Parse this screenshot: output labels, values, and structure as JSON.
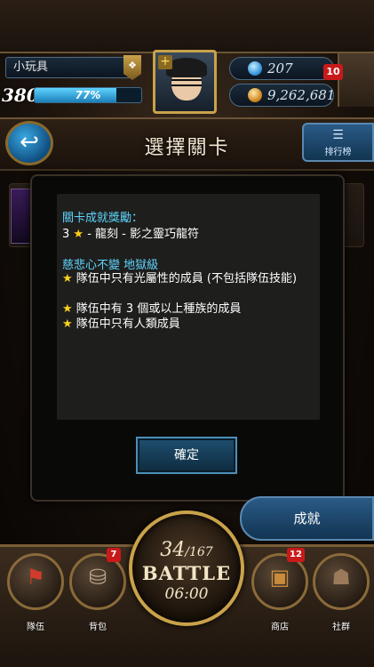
{
  "player": {
    "name": "小玩具",
    "level": "380",
    "exp_percent": 77,
    "exp_label": "77%"
  },
  "currency": {
    "gems": "207",
    "coins": "9,262,681",
    "mail_count": "10"
  },
  "header": {
    "title": "選擇關卡",
    "ranking_label": "排行榜"
  },
  "dialog": {
    "reward_heading": "關卡成就獎勵：",
    "reward_prefix": "3 ",
    "reward_star": "★",
    "reward_text": " - 龍刻 - 影之靈巧龍符",
    "mission_heading": "慈悲心不變 地獄級",
    "conditions": [
      "隊伍中只有光屬性的成員 (不包括隊伍技能)",
      "隊伍中有 3 個或以上種族的成員",
      "隊伍中只有人類成員"
    ],
    "confirm_label": "確定"
  },
  "achievement_label": "成就",
  "battle": {
    "stamina_current": "34",
    "stamina_max": "/167",
    "label": "BATTLE",
    "timer": "06:00"
  },
  "nav": {
    "team": "隊伍",
    "bag": "背包",
    "bag_badge": "7",
    "shop": "商店",
    "shop_badge": "12",
    "social": "社群"
  },
  "colors": {
    "accent_cyan": "#5fd6ff",
    "star_yellow": "#ffd21a",
    "badge_red": "#c81a1a"
  }
}
